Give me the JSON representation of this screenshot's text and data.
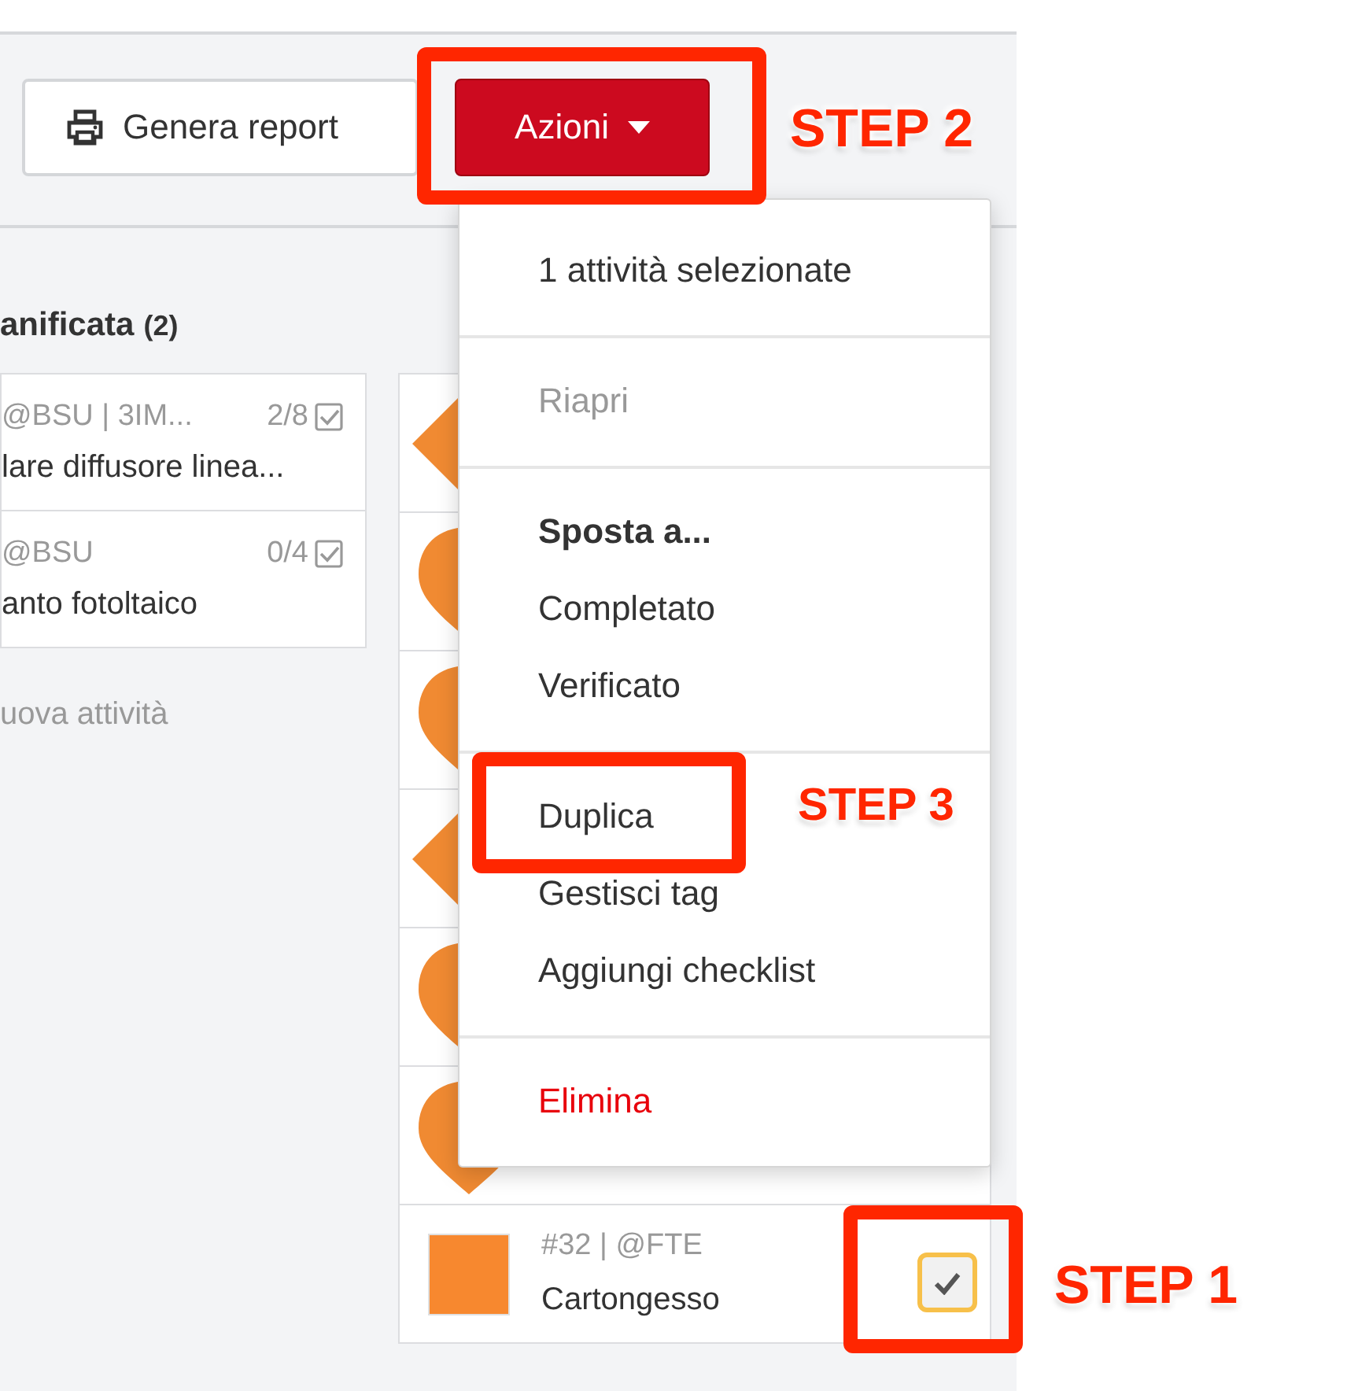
{
  "toolbar": {
    "buttons": [
      {
        "label": "Genera report",
        "kind": "print"
      },
      {
        "label": "Azioni",
        "kind": "dropdown"
      }
    ]
  },
  "left_column": {
    "title": "anificata",
    "count": "(2)",
    "cards": [
      {
        "meta": "@BSU | 3IM...",
        "progress": "2/8",
        "title": "lare diffusore linea..."
      },
      {
        "meta": "@BSU",
        "progress": "0/4",
        "title": "anto fotoltaico"
      }
    ],
    "add_label": "uova attività"
  },
  "right_column": {
    "cards": [
      {
        "kind": "diamond"
      },
      {
        "kind": "pin"
      },
      {
        "kind": "pin"
      },
      {
        "kind": "diamond"
      },
      {
        "kind": "pin"
      },
      {
        "kind": "pin"
      },
      {
        "kind": "task",
        "meta": "#32 | @FTE",
        "title": "Cartongesso",
        "checked": true
      }
    ]
  },
  "menu": {
    "sections": [
      {
        "items": [
          {
            "label": "1 attività selezionate",
            "kind": "info",
            "disabled": false
          }
        ]
      },
      {
        "items": [
          {
            "label": "Riapri",
            "kind": "action",
            "disabled": true
          }
        ]
      },
      {
        "items": [
          {
            "label": "Sposta a...",
            "kind": "heading",
            "disabled": false
          },
          {
            "label": "Completato",
            "kind": "action",
            "disabled": false
          },
          {
            "label": "Verificato",
            "kind": "action",
            "disabled": false
          }
        ]
      },
      {
        "items": [
          {
            "label": "Duplica",
            "kind": "action",
            "disabled": false
          },
          {
            "label": "Gestisci tag",
            "kind": "action",
            "disabled": false
          },
          {
            "label": "Aggiungi checklist",
            "kind": "action",
            "disabled": false
          }
        ]
      },
      {
        "items": [
          {
            "label": "Elimina",
            "kind": "danger",
            "disabled": false
          }
        ]
      }
    ]
  },
  "annotations": [
    {
      "label": "STEP 2"
    },
    {
      "label": "STEP 3"
    },
    {
      "label": "STEP 1"
    }
  ]
}
